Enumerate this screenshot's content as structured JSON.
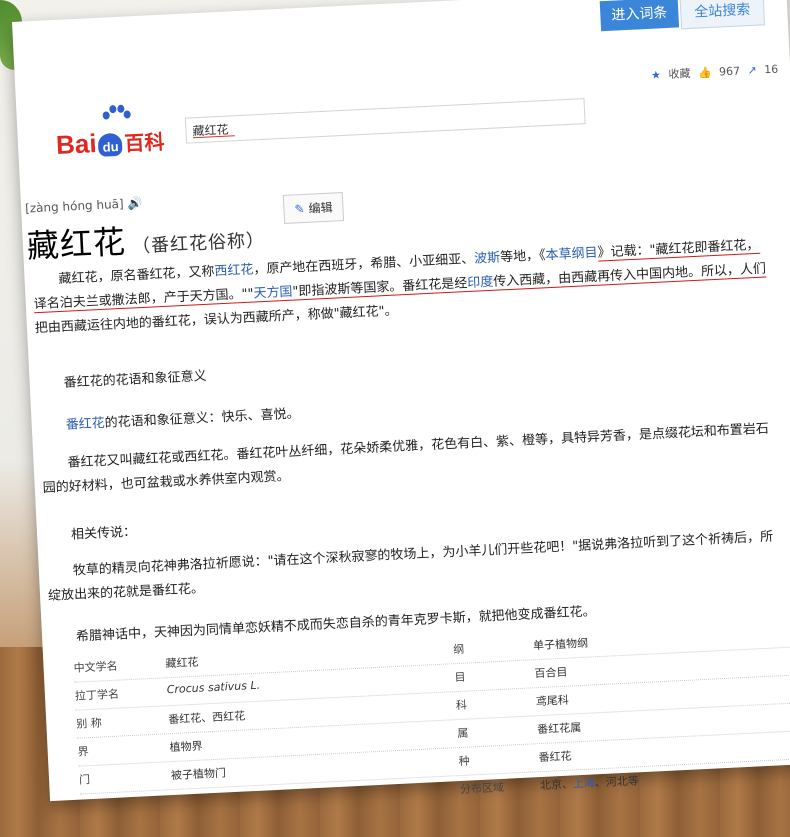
{
  "search": {
    "enter_label": "进入词条",
    "all_label": "全站搜索",
    "query": "藏红花"
  },
  "logo": {
    "part1": "Bai",
    "du": "du",
    "part2": "百科"
  },
  "actions": {
    "collect": "收藏",
    "likes": "967",
    "shares": "16"
  },
  "entry": {
    "pinyin": "[zàng hóng huā]",
    "title": "藏红花",
    "subtitle": "（番红花俗称）",
    "edit_label": "编辑"
  },
  "intro": {
    "s1": "藏红花，原名番红花，又称",
    "l1": "西红花",
    "s2": "，原产地在西班牙，希腊、小亚细亚、",
    "l2": "波斯",
    "s3": "等地，《",
    "l3": "本草纲目",
    "s4": "》记载：\"藏红花即番红花，",
    "s5": "译名泊夫兰或撒法郎，产于天方国。\"\"",
    "l4": "天方国",
    "s6": "\"即指波斯等国家。番红花是经",
    "l5": "印度",
    "s7": "传入西藏，由西藏再传入中国内地。所以，人们",
    "s8": "把由西藏运往内地的番红花，误认为西藏所产，称做\"藏红花\"。"
  },
  "body": {
    "heading1": "番红花的花语和象征意义",
    "p2_link": "番红花",
    "p2_text": "的花语和象征意义：快乐、喜悦。",
    "p3a": "番红花又叫藏红花或西红花。番红花叶丛纤细，花朵娇柔优雅，花色有白、紫、橙等，具特异芳香，是点缀花坛和布置岩石",
    "p3b": "园的好材料，也可盆栽或水养供室内观赏。",
    "heading2": "相关传说：",
    "p4a": "牧草的精灵向花神弗洛拉祈愿说：\"请在这个深秋寂寥的牧场上，为小羊儿们开些花吧！\"据说弗洛拉听到了这个祈祷后，所",
    "p4b": "绽放出来的花就是番红花。",
    "p5": "希腊神话中，天神因为同情单恋妖精不成而失恋自杀的青年克罗卡斯，就把他变成番红花。"
  },
  "infobox": {
    "left": [
      {
        "label": "中文学名",
        "value": "藏红花"
      },
      {
        "label": "拉丁学名",
        "value": "Crocus sativus L."
      },
      {
        "label": "别    称",
        "value": "番红花、西红花"
      },
      {
        "label": "界",
        "value": "植物界"
      },
      {
        "label": "门",
        "value": "被子植物门"
      }
    ],
    "right": [
      {
        "label": "纲",
        "value": "单子植物纲"
      },
      {
        "label": "目",
        "value": "百合目"
      },
      {
        "label": "科",
        "value": "鸢尾科"
      },
      {
        "label": "属",
        "value": "番红花属"
      },
      {
        "label": "种",
        "value": "番红花"
      }
    ],
    "dist_label": "分布区域",
    "dist_a": "北京、",
    "dist_link": "上海",
    "dist_b": "、河北等"
  },
  "colors": {
    "accent": "#3b86d8",
    "brand_red": "#de2920",
    "link": "#2a5db0"
  }
}
